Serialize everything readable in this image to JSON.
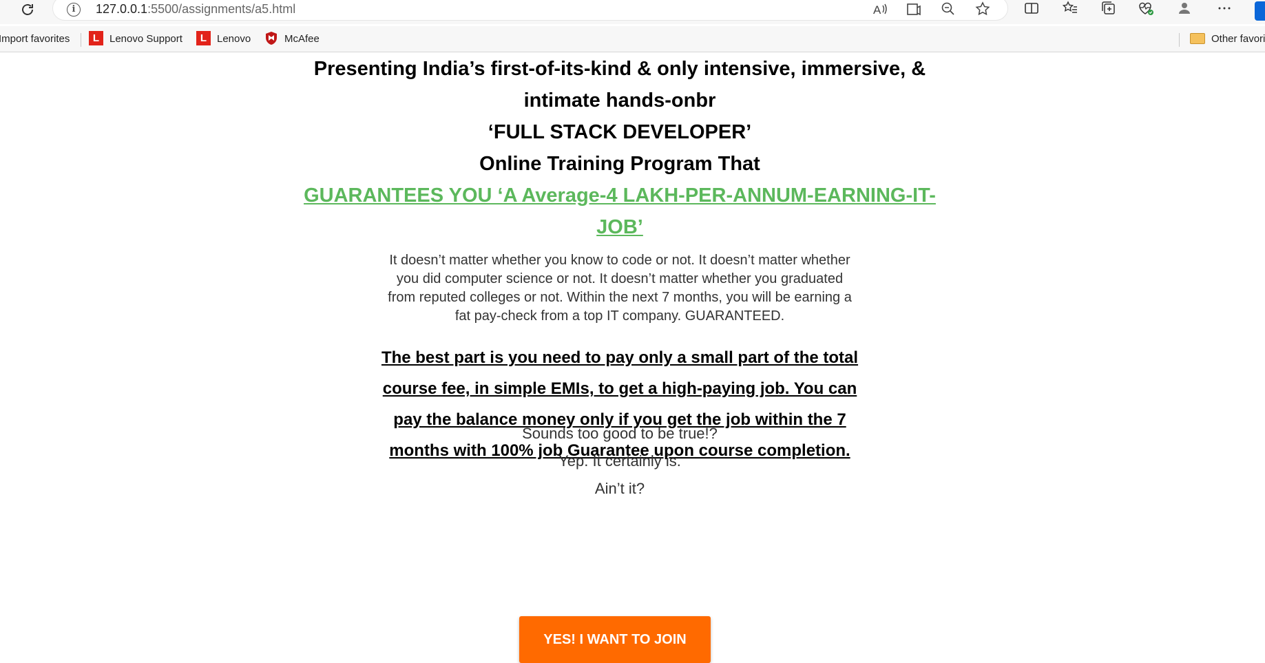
{
  "browser": {
    "url_host": "127.0.0.1",
    "url_rest": ":5500/assignments/a5.html",
    "toolbar_icons": [
      "read-aloud-icon",
      "immersive-reader-icon",
      "zoom-out-icon",
      "favorite-star-icon",
      "split-screen-icon",
      "favorites-icon",
      "collections-icon",
      "browser-essentials-icon",
      "profile-icon",
      "more-icon"
    ]
  },
  "favorites": {
    "import_label": "Import favorites",
    "items": [
      {
        "label": "Lenovo Support",
        "icon": "lenovo-icon"
      },
      {
        "label": "Lenovo",
        "icon": "lenovo-icon"
      },
      {
        "label": "McAfee",
        "icon": "mcafee-icon"
      }
    ],
    "other_label": "Other favori"
  },
  "page": {
    "headline_lines": [
      "Presenting India’s first-of-its-kind & only intensive, immersive, &",
      "intimate hands-onbr",
      "‘FULL STACK DEVELOPER’",
      "Online Training Program That"
    ],
    "guarantee_line1": "GUARANTEES YOU ‘A Average-4 LAKH-PER-ANNUM-EARNING-IT-",
    "guarantee_line2": "JOB’",
    "description": "It doesn’t matter whether you know to code or not. It doesn’t matter whether you did computer science or not. It doesn’t matter whether you graduated from reputed colleges or not. Within the next 7 months, you will be earning a fat pay-check from a top IT company. GUARANTEED.",
    "best_part": "The best part is you need to pay only a small part of the total course fee, in simple EMIs, to get a high-paying job. You can pay the balance money only if you get the job within the 7 months with 100% job Guarantee upon course completion.",
    "tease_1": "Sounds too good to be true!?",
    "tease_2": "Yep. It certainly is.",
    "tease_3": "Ain’t it?",
    "cta_label": "YES! I WANT TO JOIN"
  },
  "colors": {
    "guarantee_green": "#5cb85c",
    "cta_orange": "#ff6a00",
    "lenovo_red": "#e2231a",
    "mcafee_red": "#c01818"
  }
}
